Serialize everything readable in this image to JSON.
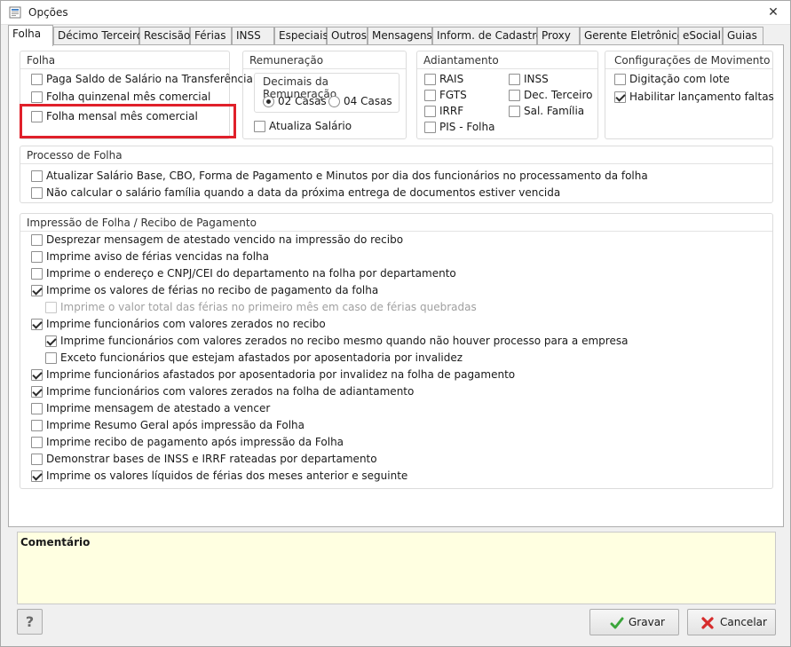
{
  "window": {
    "title": "Opções",
    "close_symbol": "✕"
  },
  "tabs": [
    {
      "label": "Folha",
      "active": true
    },
    {
      "label": "Décimo Terceiro"
    },
    {
      "label": "Rescisão"
    },
    {
      "label": "Férias"
    },
    {
      "label": "INSS"
    },
    {
      "label": "Especiais"
    },
    {
      "label": "Outros"
    },
    {
      "label": "Mensagens"
    },
    {
      "label": "Inform. de Cadastro"
    },
    {
      "label": "Proxy"
    },
    {
      "label": "Gerente Eletrônico"
    },
    {
      "label": "eSocial"
    },
    {
      "label": "Guias"
    }
  ],
  "folha": {
    "title": "Folha",
    "items": [
      {
        "label": "Paga Saldo de Salário na Transferência",
        "checked": false
      },
      {
        "label": "Folha quinzenal mês comercial",
        "checked": false
      },
      {
        "label": "Folha mensal mês comercial",
        "checked": false
      }
    ]
  },
  "remuneracao": {
    "title": "Remuneração",
    "decimais_title": "Decimais da Remuneração",
    "radio_02": {
      "label": "02 Casas",
      "checked": true
    },
    "radio_04": {
      "label": "04 Casas",
      "checked": false
    },
    "atualiza": {
      "label": "Atualiza Salário",
      "checked": false
    }
  },
  "adiantamento": {
    "title": "Adiantamento",
    "items": [
      {
        "label": "RAIS",
        "checked": false
      },
      {
        "label": "INSS",
        "checked": false
      },
      {
        "label": "FGTS",
        "checked": false
      },
      {
        "label": "Dec. Terceiro",
        "checked": false
      },
      {
        "label": "IRRF",
        "checked": false
      },
      {
        "label": "Sal. Família",
        "checked": false
      },
      {
        "label": "PIS - Folha",
        "checked": false
      }
    ]
  },
  "movimento": {
    "title": "Configurações de Movimento",
    "items": [
      {
        "label": "Digitação com lote",
        "checked": false
      },
      {
        "label": "Habilitar lançamento faltas",
        "checked": true
      }
    ]
  },
  "processo": {
    "title": "Processo de Folha",
    "items": [
      {
        "label": "Atualizar Salário Base, CBO, Forma de Pagamento e Minutos por dia dos funcionários no processamento da folha",
        "checked": false
      },
      {
        "label": "Não calcular o salário família quando a data da próxima entrega de documentos estiver vencida",
        "checked": false
      }
    ]
  },
  "impressao": {
    "title": "Impressão de Folha / Recibo de Pagamento",
    "items": [
      {
        "label": "Desprezar mensagem de atestado vencido na impressão do recibo",
        "checked": false,
        "indent": 0
      },
      {
        "label": "Imprime aviso de férias vencidas na folha",
        "checked": false,
        "indent": 0
      },
      {
        "label": "Imprime o endereço e CNPJ/CEI do departamento na folha por departamento",
        "checked": false,
        "indent": 0
      },
      {
        "label": "Imprime os valores de férias no recibo de pagamento da folha",
        "checked": true,
        "indent": 0
      },
      {
        "label": "Imprime o valor total das férias no primeiro mês em caso de férias quebradas",
        "checked": false,
        "indent": 1,
        "disabled": true
      },
      {
        "label": "Imprime funcionários com valores zerados no recibo",
        "checked": true,
        "indent": 0
      },
      {
        "label": "Imprime funcionários com valores zerados no recibo mesmo quando não houver processo para a empresa",
        "checked": true,
        "indent": 1
      },
      {
        "label": "Exceto funcionários que estejam afastados por aposentadoria por invalidez",
        "checked": false,
        "indent": 1
      },
      {
        "label": "Imprime funcionários afastados por aposentadoria por invalidez na folha de pagamento",
        "checked": true,
        "indent": 0
      },
      {
        "label": "Imprime funcionários com valores zerados na folha de adiantamento",
        "checked": true,
        "indent": 0
      },
      {
        "label": "Imprime mensagem de  atestado a vencer",
        "checked": false,
        "indent": 0
      },
      {
        "label": "Imprime Resumo Geral após impressão da Folha",
        "checked": false,
        "indent": 0
      },
      {
        "label": "Imprime recibo de pagamento após impressão da Folha",
        "checked": false,
        "indent": 0
      },
      {
        "label": "Demonstrar bases de INSS e IRRF rateadas por departamento",
        "checked": false,
        "indent": 0
      },
      {
        "label": "Imprime os valores líquidos de férias dos meses anterior e seguinte",
        "checked": true,
        "indent": 0
      }
    ]
  },
  "comentario": {
    "title": "Comentário"
  },
  "buttons": {
    "help": "?",
    "gravar": "Gravar",
    "cancelar": "Cancelar"
  },
  "colors": {
    "highlight": "#e0202a",
    "comment_bg": "#ffffe1",
    "gravar_icon": "#3aa53a",
    "cancel_icon": "#d62b2b"
  }
}
